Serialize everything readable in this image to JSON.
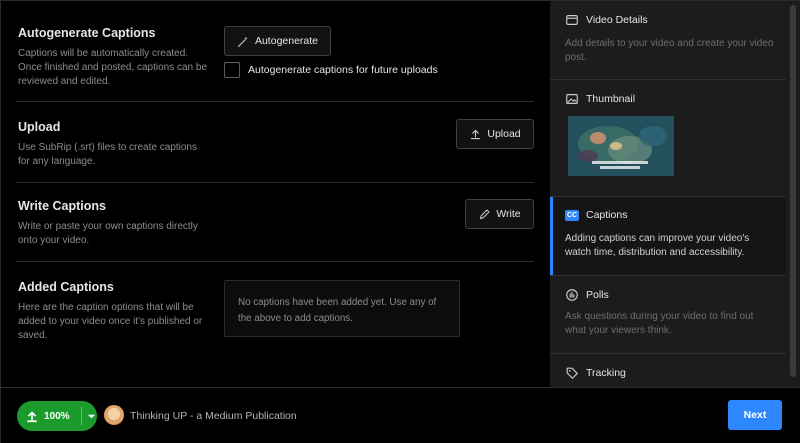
{
  "sections": {
    "autogenerate": {
      "title": "Autogenerate Captions",
      "description": "Captions will be automatically created. Once finished and posted, captions can be reviewed and edited.",
      "button_label": "Autogenerate",
      "checkbox_label": "Autogenerate captions for future uploads",
      "checkbox_checked": false
    },
    "upload": {
      "title": "Upload",
      "description": "Use SubRip (.srt) files to create captions for any language.",
      "button_label": "Upload"
    },
    "write": {
      "title": "Write Captions",
      "description": "Write or paste your own captions directly onto your video.",
      "button_label": "Write"
    },
    "added": {
      "title": "Added Captions",
      "description": "Here are the caption options that will be added to your video once it's published or saved.",
      "empty_message": "No captions have been added yet. Use any of the above to add captions."
    }
  },
  "sidebar": {
    "items": [
      {
        "icon": "video-details-icon",
        "label": "Video Details",
        "description": "Add details to your video and create your video post."
      },
      {
        "icon": "image-icon",
        "label": "Thumbnail"
      },
      {
        "icon": "cc-icon",
        "label": "Captions",
        "description": "Adding captions can improve your video's watch time, distribution and accessibility.",
        "active": true
      },
      {
        "icon": "poll-icon",
        "label": "Polls",
        "description": "Ask questions during your video to find out what your viewers think."
      },
      {
        "icon": "tag-icon",
        "label": "Tracking"
      }
    ]
  },
  "footer": {
    "upload_progress": "100%",
    "upload_progress_value": 1.0,
    "page_name": "Thinking UP - a Medium Publication",
    "next_label": "Next"
  },
  "colors": {
    "accent": "#2d88ff",
    "progress": "#1b9b2c",
    "background": "#000000",
    "sidebar": "#1c1c1d"
  }
}
